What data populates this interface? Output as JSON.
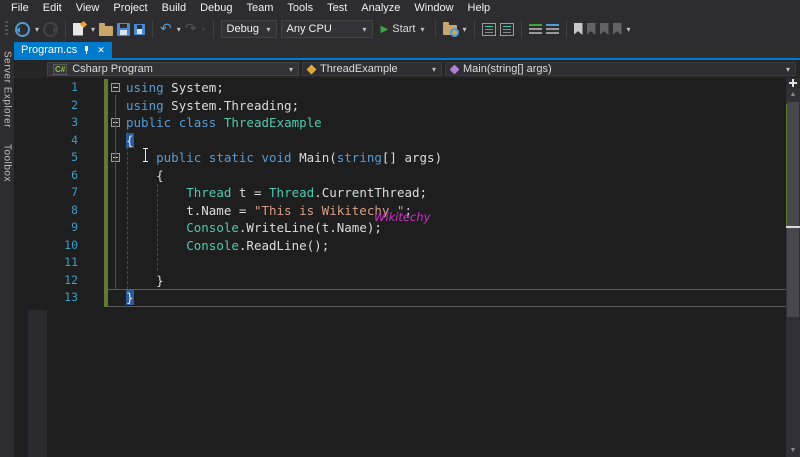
{
  "menu": {
    "items": [
      "File",
      "Edit",
      "View",
      "Project",
      "Build",
      "Debug",
      "Team",
      "Tools",
      "Test",
      "Analyze",
      "Window",
      "Help"
    ]
  },
  "toolbar": {
    "debug_combo": "Debug",
    "cpu_combo": "Any CPU",
    "start_label": "Start",
    "icon_names": [
      "toolbar-grip",
      "navigate-backward",
      "navigate-forward",
      "new-file",
      "open-file",
      "save",
      "save-all",
      "undo",
      "redo",
      "start",
      "find-in-files",
      "browse-definition",
      "view-hierarchy",
      "comment-lines",
      "uncomment-lines",
      "toggle-bookmark",
      "previous-bookmark",
      "next-bookmark",
      "clear-bookmarks",
      "toolbar-overflow"
    ],
    "undo_glyph": "↶",
    "redo_glyph": "↷",
    "play_glyph": "▶",
    "caret_glyph": "▾"
  },
  "tab": {
    "title": "Program.cs",
    "close_glyph": "✕"
  },
  "navbar": {
    "project": "Csharp Program",
    "type": "ThreadExample",
    "member": "Main(string[] args)",
    "project_icon": "C#"
  },
  "sidebar": {
    "tabs": [
      "Server Explorer",
      "Toolbox"
    ]
  },
  "editor": {
    "watermark": "Wikitechy",
    "lines": [
      {
        "n": "1",
        "fold": true,
        "tokens": [
          [
            "using",
            "kw"
          ],
          [
            " System;",
            "pl"
          ]
        ]
      },
      {
        "n": "2",
        "tokens": [
          [
            "using",
            "kw"
          ],
          [
            " System.Threading;",
            "pl"
          ]
        ]
      },
      {
        "n": "3",
        "fold": true,
        "tokens": [
          [
            "public",
            "kw"
          ],
          [
            " ",
            "pl"
          ],
          [
            "class",
            "kw"
          ],
          [
            " ",
            "pl"
          ],
          [
            "ThreadExample",
            "type"
          ]
        ]
      },
      {
        "n": "4",
        "tokens": [
          [
            "{",
            "brace"
          ]
        ]
      },
      {
        "n": "5",
        "fold": true,
        "tokens": [
          [
            "    ",
            "pl"
          ],
          [
            "public",
            "kw"
          ],
          [
            " ",
            "pl"
          ],
          [
            "static",
            "kw"
          ],
          [
            " ",
            "pl"
          ],
          [
            "void",
            "kw"
          ],
          [
            " Main(",
            "pl"
          ],
          [
            "string",
            "kw"
          ],
          [
            "[] args)",
            "pl"
          ]
        ]
      },
      {
        "n": "6",
        "tokens": [
          [
            "    {",
            "pl"
          ]
        ]
      },
      {
        "n": "7",
        "tokens": [
          [
            "        ",
            "pl"
          ],
          [
            "Thread",
            "type"
          ],
          [
            " t = ",
            "pl"
          ],
          [
            "Thread",
            "type"
          ],
          [
            ".CurrentThread;",
            "pl"
          ]
        ]
      },
      {
        "n": "8",
        "tokens": [
          [
            "        t.Name = ",
            "pl"
          ],
          [
            "\"This is Wikitechy \"",
            "str"
          ],
          [
            ";",
            "pl"
          ]
        ]
      },
      {
        "n": "9",
        "tokens": [
          [
            "        ",
            "pl"
          ],
          [
            "Console",
            "type"
          ],
          [
            ".WriteLine(t.Name);",
            "pl"
          ]
        ]
      },
      {
        "n": "10",
        "tokens": [
          [
            "        ",
            "pl"
          ],
          [
            "Console",
            "type"
          ],
          [
            ".ReadLine();",
            "pl"
          ]
        ]
      },
      {
        "n": "11",
        "tokens": []
      },
      {
        "n": "12",
        "tokens": [
          [
            "    }",
            "pl"
          ]
        ]
      },
      {
        "n": "13",
        "current": true,
        "tokens": [
          [
            "}",
            "brace"
          ]
        ]
      }
    ],
    "scrollbar": {
      "up_glyph": "▲",
      "down_glyph": "▼"
    }
  },
  "colors": {
    "accent": "#007ACC",
    "keyword": "#569CD6",
    "type": "#4EC9B0",
    "string": "#D69D85",
    "plain": "#DCDCDC",
    "line_number": "#3F9CC6",
    "watermark": "#CC2ECC",
    "change_bar": "#5E7B31"
  }
}
